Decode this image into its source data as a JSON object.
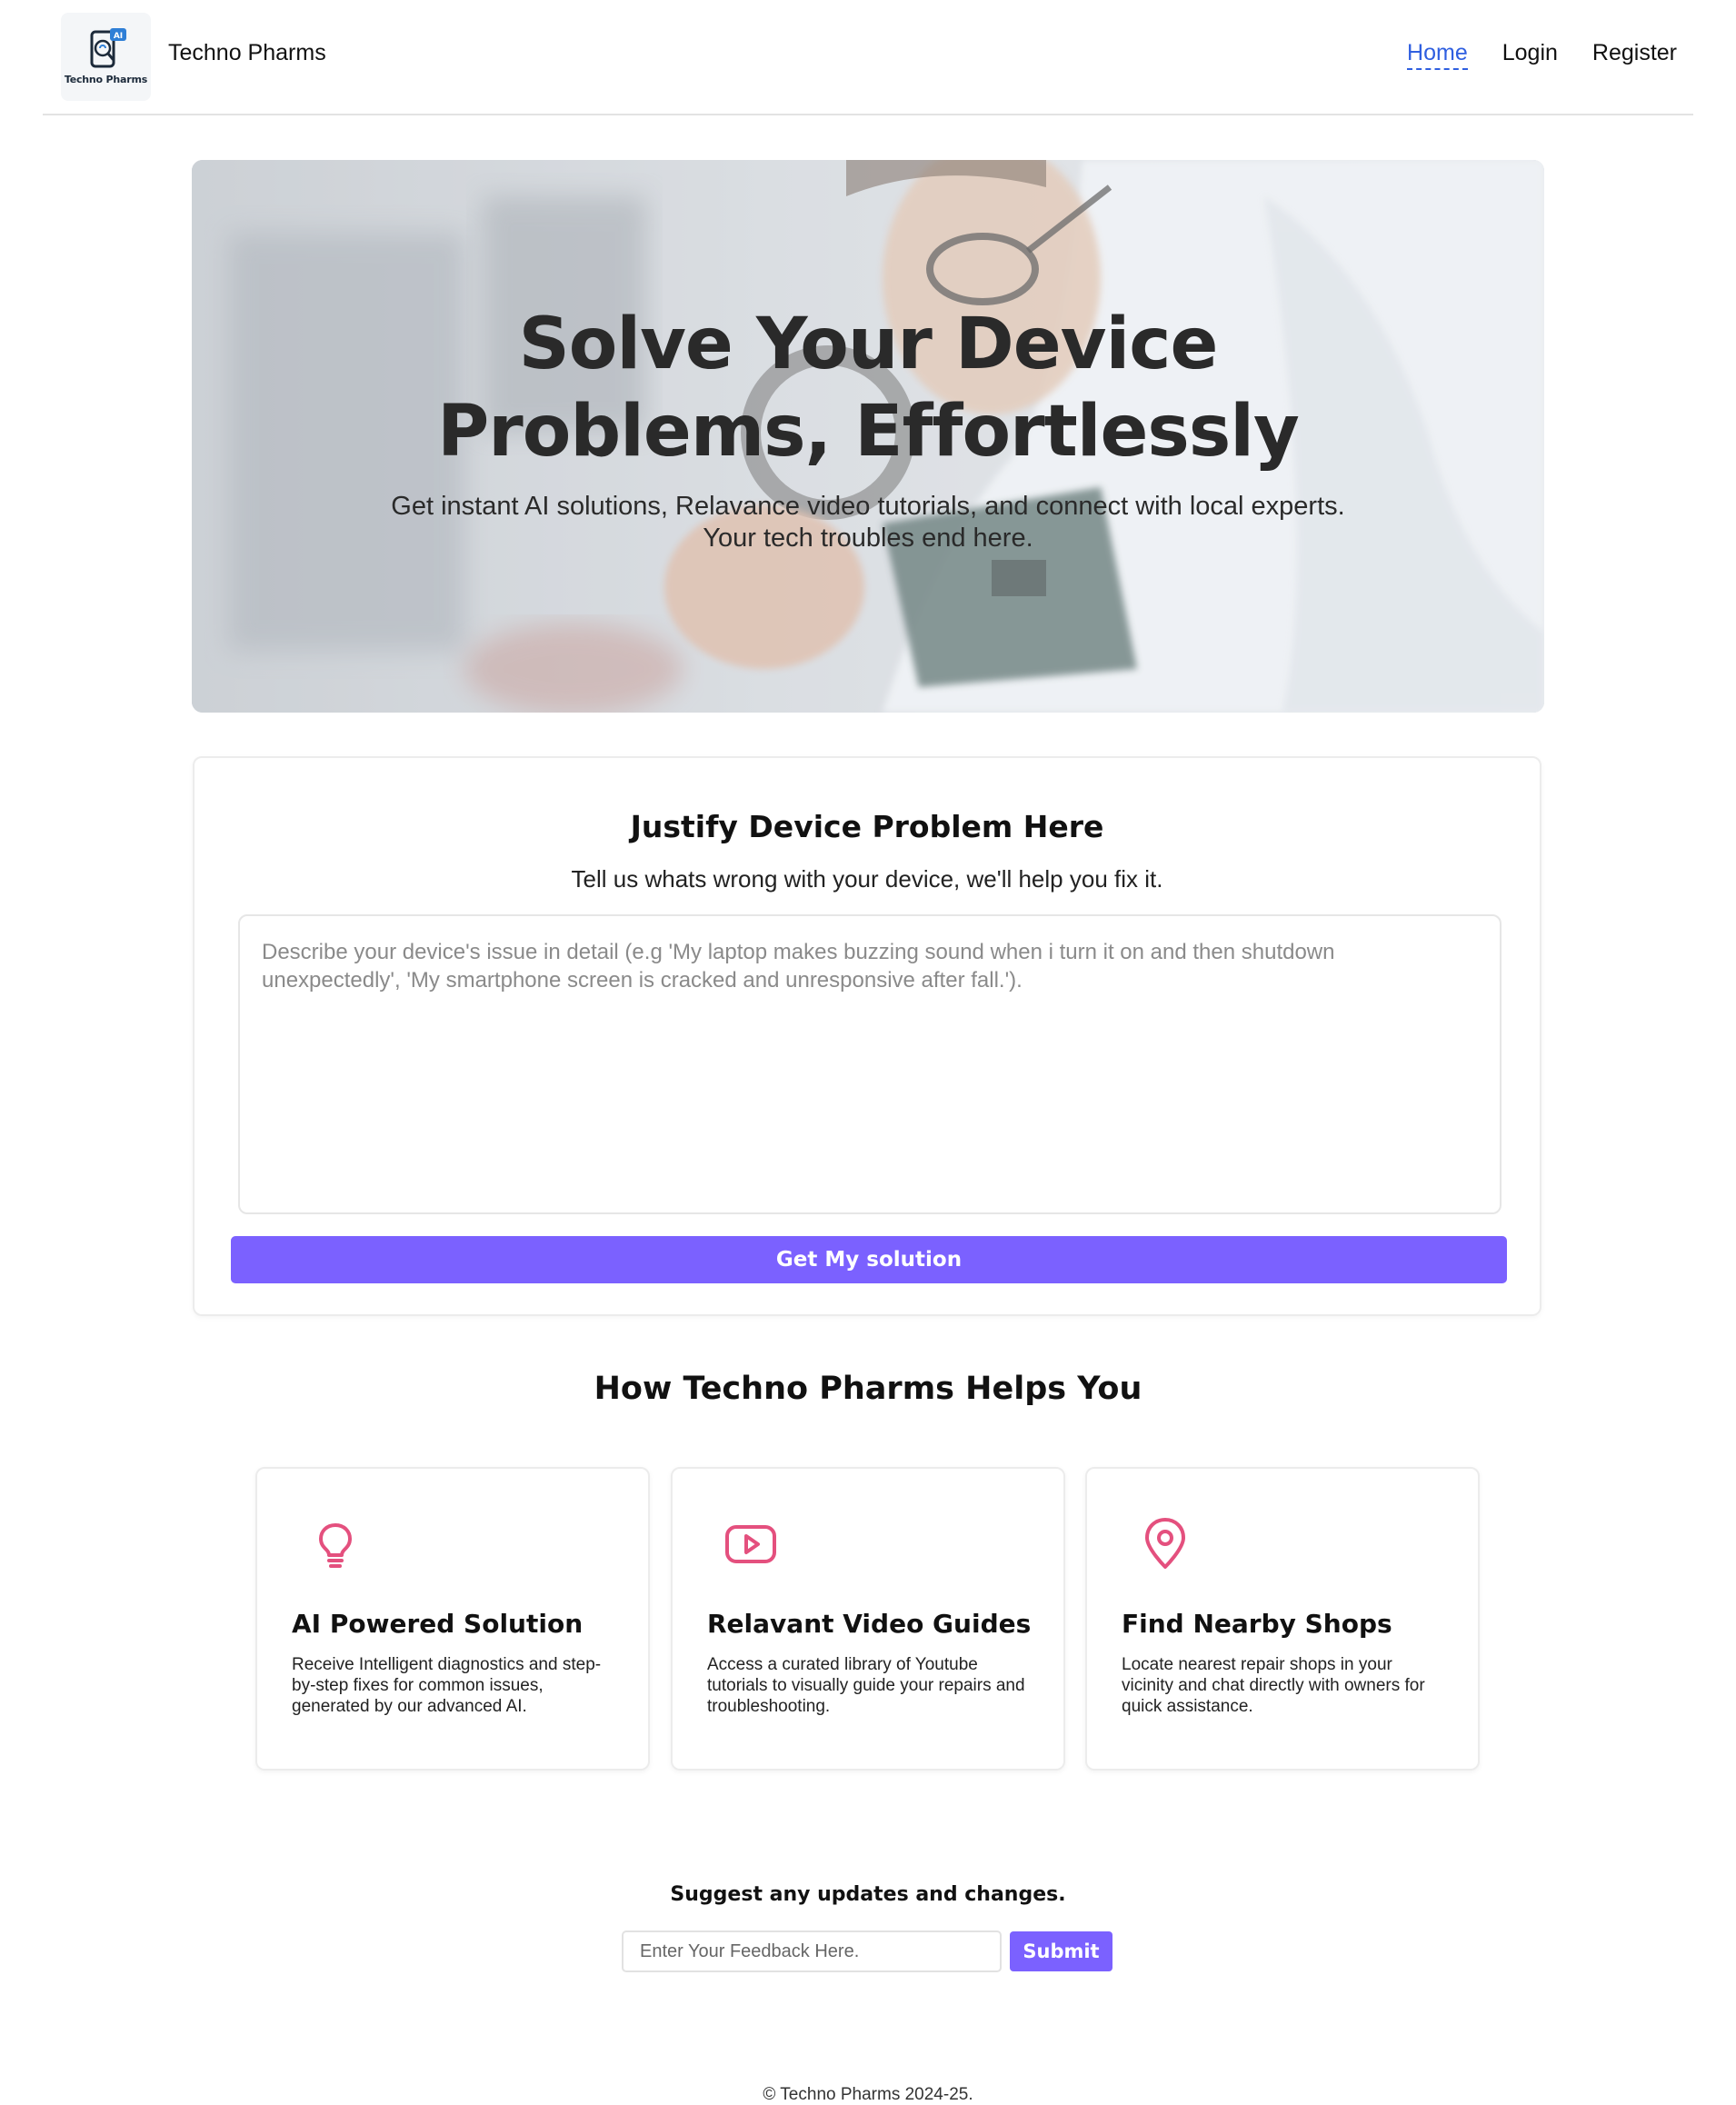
{
  "navbar": {
    "brand_name": "Techno Pharms",
    "logo_text": "Techno Pharms",
    "logo_badge": "AI",
    "links": [
      {
        "label": "Home",
        "active": true
      },
      {
        "label": "Login",
        "active": false
      },
      {
        "label": "Register",
        "active": false
      }
    ]
  },
  "hero": {
    "title_line1": "Solve Your Device",
    "title_line2": "Problems, Effortlessly",
    "subtitle_line1": "Get instant AI solutions, Relavance video tutorials, and connect with local experts.",
    "subtitle_line2": "Your tech troubles end here."
  },
  "problem": {
    "title": "Justify Device Problem Here",
    "subtitle": "Tell us whats wrong with your device, we'll help you fix it.",
    "placeholder": "Describe your device's issue in detail (e.g 'My laptop makes buzzing sound when i turn it on and then shutdown unexpectedly', 'My smartphone screen is cracked and unresponsive after fall.').",
    "value": "",
    "button_label": "Get My solution"
  },
  "features": {
    "heading": "How Techno Pharms Helps You",
    "icon_color": "#e4507e",
    "cards": [
      {
        "icon": "lightbulb-icon",
        "title": "AI Powered Solution",
        "description": "Receive Intelligent diagnostics and step-by-step fixes for common issues, generated by our advanced AI."
      },
      {
        "icon": "video-play-icon",
        "title": "Relavant Video Guides",
        "description": "Access a curated library of Youtube tutorials to visually guide your repairs and troubleshooting."
      },
      {
        "icon": "map-pin-icon",
        "title": "Find Nearby Shops",
        "description": "Locate nearest repair shops in your vicinity and chat directly with owners for quick assistance."
      }
    ]
  },
  "feedback": {
    "title": "Suggest any updates and changes.",
    "placeholder": "Enter Your Feedback Here.",
    "value": "",
    "button_label": "Submit"
  },
  "footer": {
    "copyright": "© Techno Pharms 2024-25."
  },
  "colors": {
    "accent": "#7b61ff",
    "active_link": "#2f5fe0",
    "icon": "#e4507e"
  }
}
